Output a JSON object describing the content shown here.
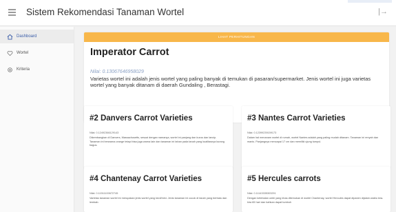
{
  "header": {
    "title": "Sistem Rekomendasi Tanaman Wortel",
    "menu_icon": "hamburger-icon",
    "collapse_glyph": "|→"
  },
  "sidebar": {
    "items": [
      {
        "label": "Dashboard",
        "icon": "home-icon",
        "active": true
      },
      {
        "label": "Wortel",
        "icon": "heart-icon",
        "active": false
      },
      {
        "label": "Kriteria",
        "icon": "gear-icon",
        "active": false
      }
    ]
  },
  "top": {
    "button_label": "LIHAT PERHITUNGAN",
    "title": "Imperator Carrot",
    "score": "Nilai: 0.13067646958029",
    "description": "Varietas wortel ini adalah jenis wortel yang paling banyak di temukan di pasaran/supermarket. Jenis wortel ini juga varietas wortel yang banyak ditanam di daerah Gundaling , Berastagi."
  },
  "cards": [
    {
      "title": "#2 Danvers Carrot Varieties",
      "score": "Nilai: 0.12492366129143",
      "description": "Dikembangkan di Danvers, Massachusetts, sesuai dengan namanya, wortel ini panjang dan kurus dan lancip. Tanaman ini berwarna orange tetapi bisa juga warna lain dan tanaman ini tahan pada tanah yang kualitasnya kurang bagus."
    },
    {
      "title": "#3 Nantes Carrot Varieties",
      "score": "Nilai: 0.12399239159173",
      "description": "Dalam hal menanam wortel di rumah, wortel Nantes adalah yang paling mudah ditanam. Tanaman ini renyah dan manis. Panjangnya mencapai 17 cm dan memiliki ujung tumpul."
    },
    {
      "title": "#4 Chantenay Carrot Varieties",
      "score": "Nilai: 0.11511100672745",
      "description": "Varietas tanaman wortel ini merupakan jenis wortel yang kecil/mini. Jenis tanaman ini cocok di tanah yang berbatu dan lembab."
    },
    {
      "title": "#5 Hercules carrots",
      "score": "Nilai: 0.11143335303291",
      "description": "Dengan ketebalan umbi yang khas ditemukan di wortel Chantenay, wortel Hercules dapat dipanen dijalam waktu kira-kira 65 hari dan bahkan dapat tumbuh"
    }
  ],
  "colors": {
    "accent": "#f8b74a",
    "active_link": "#3a5da8",
    "score_text": "#8aa0c4",
    "background": "#f2f2f2"
  }
}
